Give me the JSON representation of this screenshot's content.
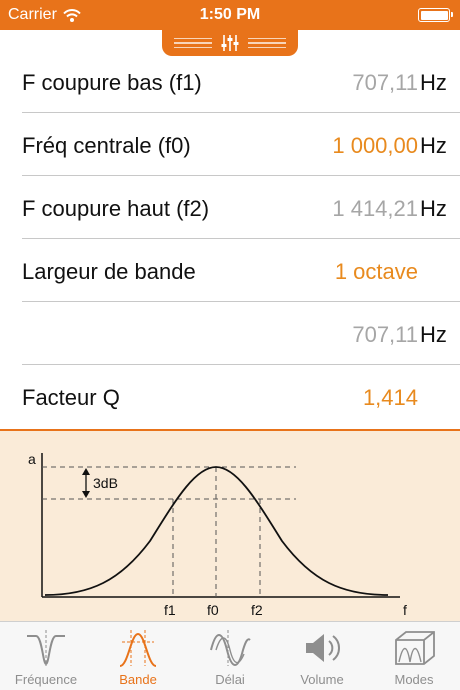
{
  "status_bar": {
    "carrier": "Carrier",
    "time": "1:50 PM"
  },
  "rows": [
    {
      "label": "F coupure bas (f1)",
      "value": "707,11",
      "unit": "Hz",
      "value_style": "grey"
    },
    {
      "label": "Fréq centrale (f0)",
      "value": "1 000,00",
      "unit": "Hz",
      "value_style": "orange"
    },
    {
      "label": "F coupure haut (f2)",
      "value": "1 414,21",
      "unit": "Hz",
      "value_style": "grey"
    },
    {
      "label": "Largeur de bande",
      "value": "1 octave",
      "unit": "",
      "value_style": "orange"
    },
    {
      "label": "",
      "value": "707,11",
      "unit": "Hz",
      "value_style": "grey"
    },
    {
      "label": "Facteur Q",
      "value": "1,414",
      "unit": "",
      "value_style": "orange"
    }
  ],
  "graph": {
    "y_axis_label": "a",
    "x_axis_label": "f",
    "db_label": "3dB",
    "marker_f1": "f1",
    "marker_f0": "f0",
    "marker_f2": "f2"
  },
  "tabs": [
    {
      "label": "Fréquence",
      "icon": "frequency-curve-icon",
      "active": false
    },
    {
      "label": "Bande",
      "icon": "band-curve-icon",
      "active": true
    },
    {
      "label": "Délai",
      "icon": "delay-wave-icon",
      "active": false
    },
    {
      "label": "Volume",
      "icon": "speaker-icon",
      "active": false
    },
    {
      "label": "Modes",
      "icon": "room-modes-icon",
      "active": false
    }
  ],
  "colors": {
    "accent": "#e8731a",
    "value_orange": "#e88a1e",
    "value_grey": "#a6a6a6",
    "graph_background": "#faebd8"
  }
}
